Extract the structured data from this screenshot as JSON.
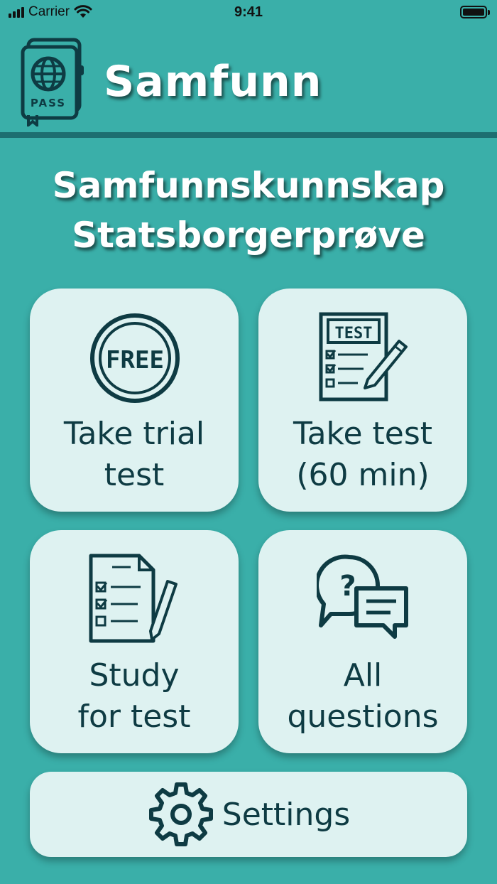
{
  "status_bar": {
    "carrier": "Carrier",
    "time": "9:41"
  },
  "header": {
    "logo_text": "PASS",
    "app_title": "Samfunn"
  },
  "main": {
    "title_line1": "Samfunnskunnskap",
    "title_line2": "Statsborgerprøve"
  },
  "cards": {
    "trial": {
      "icon_text": "FREE",
      "label_line1": "Take trial",
      "label_line2": "test"
    },
    "test": {
      "icon_text": "TEST",
      "label_line1": "Take test",
      "label_line2": "(60 min)"
    },
    "study": {
      "label_line1": "Study",
      "label_line2": "for test"
    },
    "all": {
      "icon_text": "?",
      "label_line1": "All",
      "label_line2": "questions"
    },
    "settings": {
      "label": "Settings"
    }
  },
  "colors": {
    "background": "#3aafa9",
    "card": "#def2f1",
    "ink": "#0e3b43",
    "divider": "#1d6e70"
  }
}
